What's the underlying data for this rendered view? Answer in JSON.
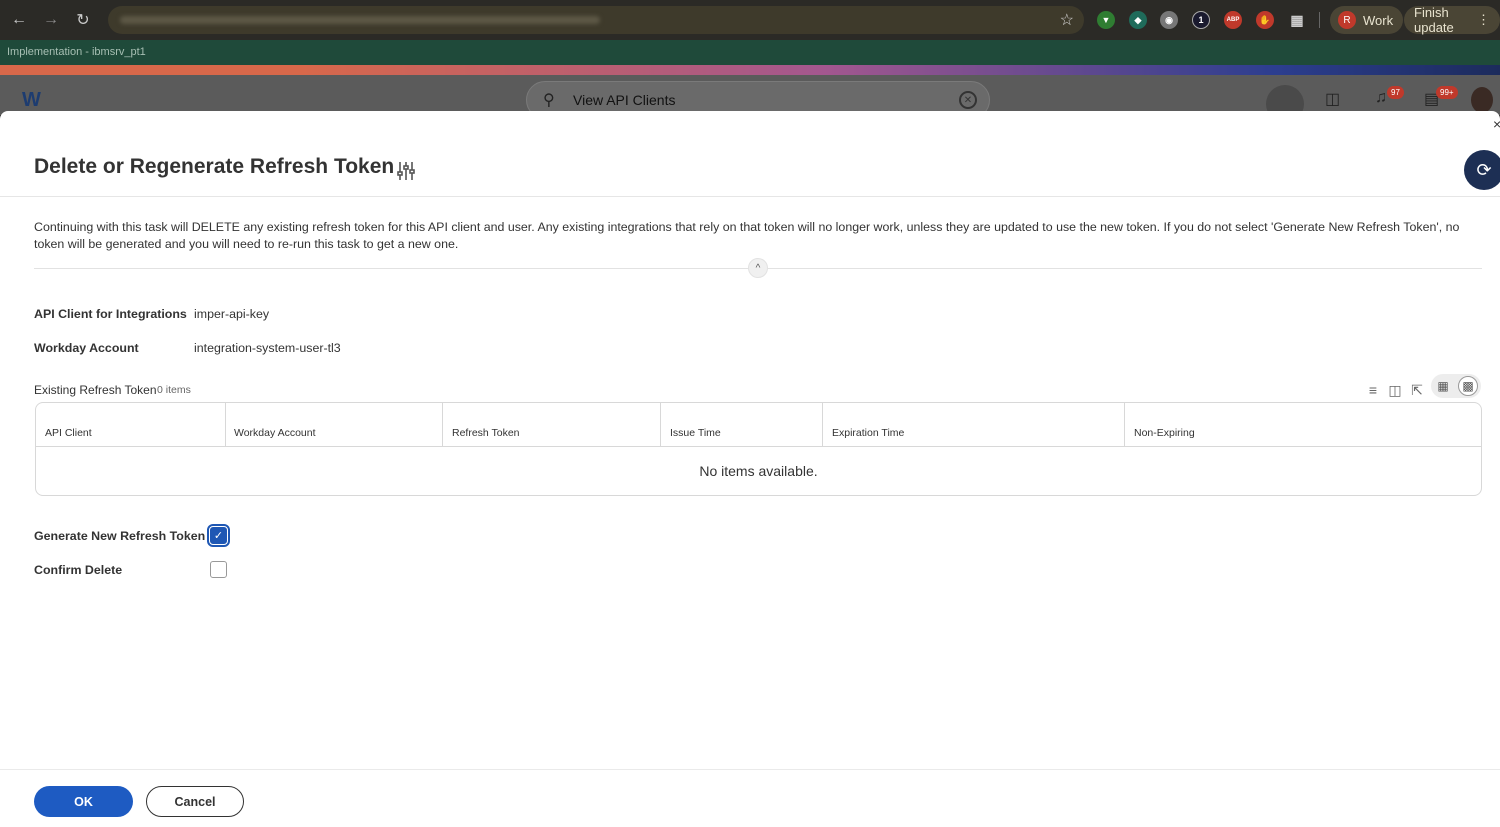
{
  "browser": {
    "profile_initial": "R",
    "profile_label": "Work",
    "update_label": "Finish update",
    "environment_label": "Implementation - ibmsrv_pt1",
    "extension_badge_1": "1",
    "extension_badge_abp": "ABP"
  },
  "app": {
    "search_text": "View API Clients",
    "notifications_count": "97",
    "inbox_count": "99+"
  },
  "modal": {
    "title": "Delete or Regenerate Refresh Token",
    "instructions": "Continuing with this task will DELETE any existing refresh token for this API client and user. Any existing integrations that rely on that token will no longer work, unless they are updated to use the new token. If you do not select 'Generate New Refresh Token', no token will be generated and you will need to re-run this task to get a new one.",
    "fields": [
      {
        "label": "API Client for Integrations",
        "value": "imper-api-key"
      },
      {
        "label": "Workday Account",
        "value": "integration-system-user-tl3"
      }
    ],
    "grid": {
      "title": "Existing Refresh Token",
      "count": "0 items",
      "columns": [
        "API Client",
        "Workday Account",
        "Refresh Token",
        "Issue Time",
        "Expiration Time",
        "Non-Expiring"
      ],
      "empty_text": "No items available."
    },
    "checkboxes": [
      {
        "label": "Generate New Refresh Token",
        "checked": true
      },
      {
        "label": "Confirm Delete",
        "checked": false
      }
    ],
    "ok_label": "OK",
    "cancel_label": "Cancel"
  },
  "colors": {
    "primary": "#1e5bc2",
    "env_bar": "#1f4a3a"
  }
}
